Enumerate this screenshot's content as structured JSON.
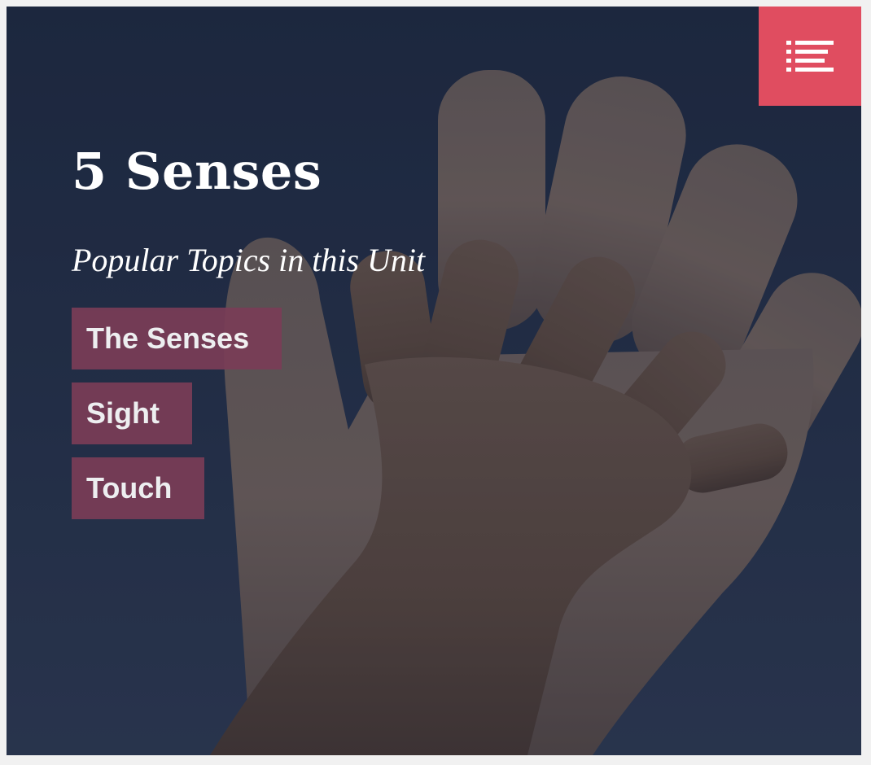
{
  "hero": {
    "title": "5 Senses",
    "subtitle": "Popular Topics in this Unit",
    "image_alt": "child hand placed on adult hand against blue sky"
  },
  "menu": {
    "icon": "list-menu-icon",
    "background": "#e04d60"
  },
  "topics": [
    {
      "label": "The Senses"
    },
    {
      "label": "Sight"
    },
    {
      "label": "Touch"
    }
  ],
  "colors": {
    "topic_background": "#7a3d57",
    "menu_background": "#e04d60",
    "text": "#ffffff",
    "sky": "#233049"
  }
}
